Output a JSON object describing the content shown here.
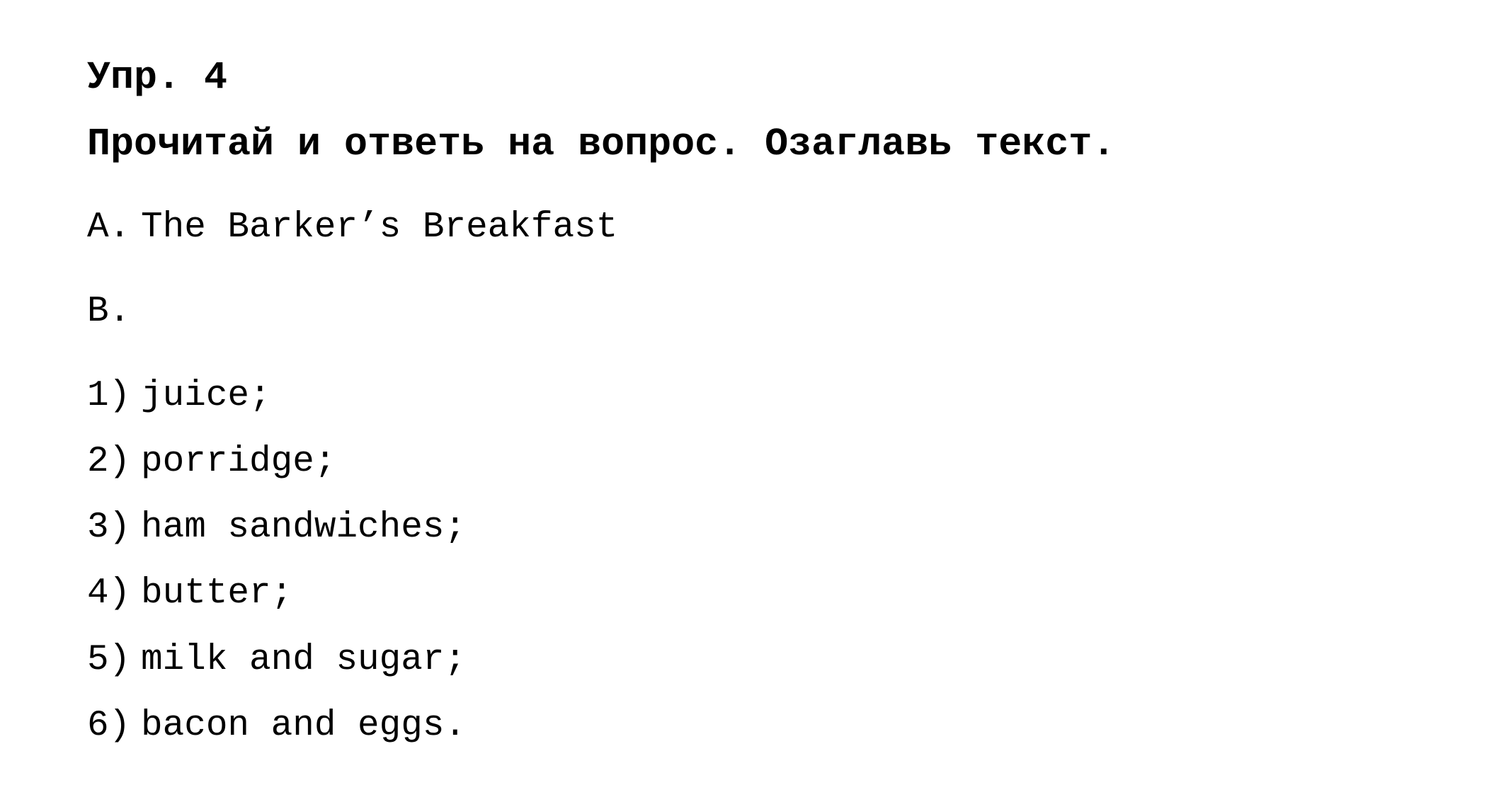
{
  "exercise": {
    "title": "Упр. 4",
    "instruction": "Прочитай и ответь на вопрос. Озаглавь текст."
  },
  "section_a": {
    "label": "A.",
    "text": "The Barker’s Breakfast"
  },
  "section_b": {
    "label": "B.",
    "text": ""
  },
  "items": [
    {
      "label": "1)",
      "text": "juice;"
    },
    {
      "label": "2)",
      "text": "porridge;"
    },
    {
      "label": "3)",
      "text": "ham sandwiches;"
    },
    {
      "label": "4)",
      "text": "butter;"
    },
    {
      "label": "5)",
      "text": "milk and sugar;"
    },
    {
      "label": "6)",
      "text": "bacon and eggs."
    }
  ]
}
